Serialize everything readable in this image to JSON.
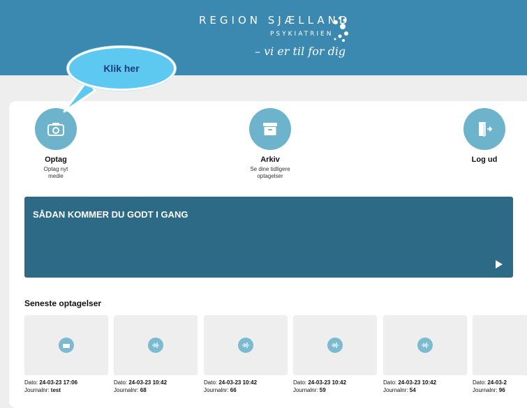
{
  "header": {
    "brand_line1": "REGION SJÆLLAND",
    "brand_line2": "PSYKIATRIEN",
    "brand_tagline": "– vi er til for dig"
  },
  "callout": {
    "text": "Klik her"
  },
  "nav": [
    {
      "title": "Optag",
      "sub1": "Optag nyt",
      "sub2": "medie",
      "icon": "camera-icon"
    },
    {
      "title": "Arkiv",
      "sub1": "Se dine tidligere",
      "sub2": "optagelser",
      "icon": "archive-box-icon"
    },
    {
      "title": "Log ud",
      "sub1": "",
      "sub2": "",
      "icon": "logout-door-icon"
    }
  ],
  "banner": {
    "title": "SÅDAN KOMMER DU GODT I GANG"
  },
  "recent": {
    "title": "Seneste optagelser",
    "date_label": "Dato: ",
    "journal_label": "Journalnr: ",
    "items": [
      {
        "date": "24-03-23 17:06",
        "journal": "test",
        "icon": "video-icon"
      },
      {
        "date": "24-03-23 10:42",
        "journal": "68",
        "icon": "audio-wave-icon"
      },
      {
        "date": "24-03-23 10:42",
        "journal": "66",
        "icon": "audio-wave-icon"
      },
      {
        "date": "24-03-23 10:42",
        "journal": "59",
        "icon": "audio-wave-icon"
      },
      {
        "date": "24-03-23 10:42",
        "journal": "54",
        "icon": "audio-wave-icon"
      },
      {
        "date": "24-03-2",
        "journal": "96",
        "icon": "audio-wave-icon"
      }
    ]
  },
  "colors": {
    "header": "#3b89b0",
    "banner": "#2c6a86",
    "nav_circle": "#6db3cc",
    "callout": "#5ec9f0"
  }
}
